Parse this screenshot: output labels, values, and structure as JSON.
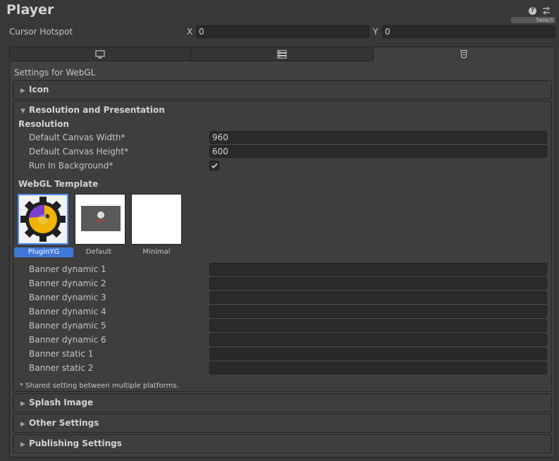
{
  "header": {
    "title": "Player",
    "select_label": "Select"
  },
  "cursor_hotspot": {
    "label": "Cursor Hotspot",
    "x_label": "X",
    "x_value": "0",
    "y_label": "Y",
    "y_value": "0"
  },
  "tabs": [
    {
      "icon": "monitor-icon",
      "active": false
    },
    {
      "icon": "server-icon",
      "active": false
    },
    {
      "icon": "html5-icon",
      "active": true
    }
  ],
  "settings_for": "Settings for WebGL",
  "sections": {
    "icon": "Icon",
    "resolution": "Resolution and Presentation",
    "splash": "Splash Image",
    "other": "Other Settings",
    "publishing": "Publishing Settings"
  },
  "resolution": {
    "heading": "Resolution",
    "canvas_width_label": "Default Canvas Width*",
    "canvas_width_value": "960",
    "canvas_height_label": "Default Canvas Height*",
    "canvas_height_value": "600",
    "run_in_background_label": "Run In Background*",
    "run_in_background": true
  },
  "webgl_template": {
    "heading": "WebGL Template",
    "templates": [
      {
        "name": "PluginYG",
        "selected": true
      },
      {
        "name": "Default",
        "selected": false
      },
      {
        "name": "Minimal",
        "selected": false
      }
    ]
  },
  "banners": [
    {
      "label": "Banner dynamic 1",
      "value": ""
    },
    {
      "label": "Banner dynamic 2",
      "value": ""
    },
    {
      "label": "Banner dynamic 3",
      "value": ""
    },
    {
      "label": "Banner dynamic 4",
      "value": ""
    },
    {
      "label": "Banner dynamic 5",
      "value": ""
    },
    {
      "label": "Banner dynamic 6",
      "value": ""
    },
    {
      "label": "Banner static 1",
      "value": ""
    },
    {
      "label": "Banner static 2",
      "value": ""
    }
  ],
  "shared_note": "* Shared setting between multiple platforms.",
  "colors": {
    "background": "#383838",
    "selection_blue": "#3d78d6"
  }
}
